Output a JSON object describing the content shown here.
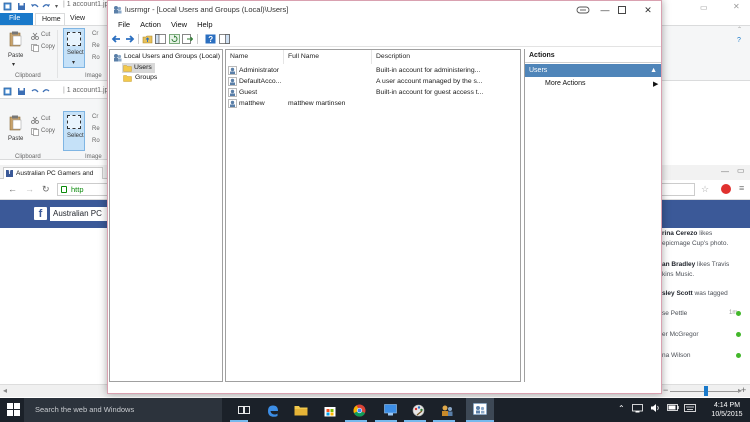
{
  "paint": {
    "title": "1 account1.jpg",
    "tab_file": "File",
    "tab_home": "Home",
    "tab_view": "View",
    "paste": "Paste",
    "cut": "Cut",
    "copy": "Copy",
    "select": "Select",
    "clipboard": "Clipboard",
    "image": "Image",
    "crop_frag": "Cr",
    "resize_frag": "Re",
    "rotate_frag": "Ro"
  },
  "paint2": {
    "title": "1 account1.jp"
  },
  "browser": {
    "tab_title": "Australian PC Gamers and",
    "url_frag": "http",
    "fb_group": "Australian PC"
  },
  "feed": {
    "line1_name": "rina Cerezo",
    "line1_rest": " likes",
    "line2": "epicmage Cup's photo.",
    "line3_name": "an Bradley",
    "line3_rest": " likes Travis",
    "line4": "kins Music.",
    "line5_name": "sley Scott",
    "line5_rest": " was tagged",
    "person1": "se Pettle",
    "person1_time": "1m",
    "person2": "er McGregor",
    "person3": "na Wilson"
  },
  "window": {
    "title": "lusrmgr - [Local Users and Groups (Local)\\Users]",
    "menu": [
      "File",
      "Action",
      "View",
      "Help"
    ]
  },
  "tree": {
    "root": "Local Users and Groups (Local)",
    "children": [
      "Users",
      "Groups"
    ]
  },
  "list": {
    "columns": [
      "Name",
      "Full Name",
      "Description"
    ],
    "rows": [
      {
        "name": "Administrator",
        "full_name": "",
        "description": "Built-in account for administering..."
      },
      {
        "name": "DefaultAcco...",
        "full_name": "",
        "description": "A user account managed by the s..."
      },
      {
        "name": "Guest",
        "full_name": "",
        "description": "Built-in account for guest access t..."
      },
      {
        "name": "matthew",
        "full_name": "matthew martinsen",
        "description": ""
      }
    ]
  },
  "actions": {
    "header": "Actions",
    "group": "Users",
    "item": "More Actions"
  },
  "taskbar": {
    "search": "Search the web and Windows",
    "time": "4:14 PM",
    "date": "10/5/2015"
  },
  "colors": {
    "paint_file_tab": "#1979ca",
    "facebook_blue": "#3b5998",
    "actions_highlight": "#4f85b9",
    "taskbar": "#1b2129"
  }
}
